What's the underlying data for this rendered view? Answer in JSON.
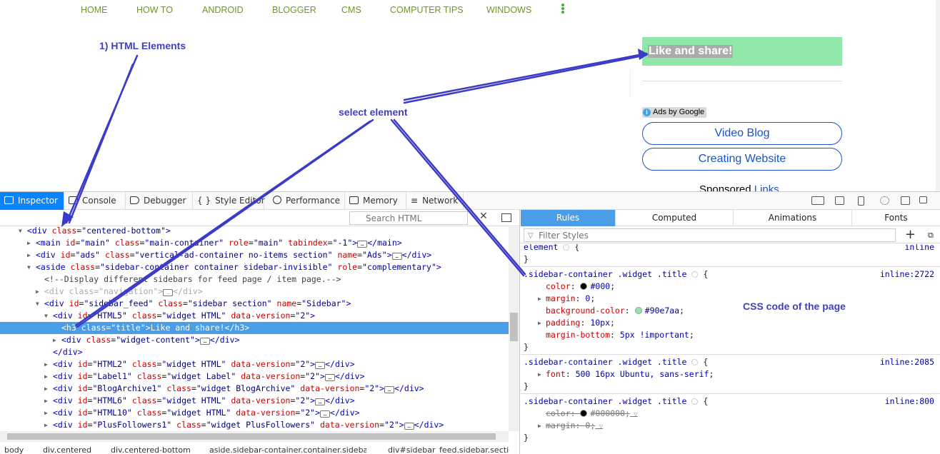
{
  "site": {
    "nav": [
      "HOME",
      "HOW TO",
      "ANDROID",
      "BLOGGER",
      "CMS",
      "COMPUTER TIPS",
      "WINDOWS"
    ],
    "like_title": "Like and share!",
    "ads_label": "Ads by Google",
    "ads_info": "i",
    "ad_links": [
      "Video Blog",
      "Creating Website"
    ],
    "sponsored_text": "Sponsored",
    "sponsored_link": "Links"
  },
  "annotations": {
    "html": "1) HTML Elements",
    "select": "select element",
    "css": "CSS code of the page"
  },
  "devtools": {
    "tabs": [
      "Inspector",
      "Console",
      "Debugger",
      "Style Editor",
      "Performance",
      "Memory",
      "Network"
    ],
    "search_placeholder": "Search HTML",
    "side_tabs": [
      "Rules",
      "Computed",
      "Animations",
      "Fonts"
    ],
    "filter_placeholder": "Filter Styles",
    "breadcrumbs": [
      "body",
      "div.centered",
      "div.centered-bottom",
      "aside.sidebar-container.container.sidebar-invisible",
      "div#sidebar_feed.sidebar.section"
    ],
    "tree": [
      {
        "open": "<div",
        "attrs": [
          [
            "class",
            "\"centered-bottom\""
          ]
        ],
        "close": ">"
      },
      {
        "open": "<main",
        "attrs": [
          [
            "id",
            "\"main\""
          ],
          [
            "class",
            "\"main-container\""
          ],
          [
            "role",
            "\"main\""
          ],
          [
            "tabindex",
            "\"-1\""
          ]
        ],
        "close": ">",
        "ell": "…",
        "end": "</main>"
      },
      {
        "open": "<div",
        "attrs": [
          [
            "id",
            "\"ads\""
          ],
          [
            "class",
            "\"vertical-ad-container no-items section\""
          ],
          [
            "name",
            "\"Ads\""
          ]
        ],
        "close": ">",
        "ell": "…",
        "end": "</div>"
      },
      {
        "open": "<aside",
        "attrs": [
          [
            "class",
            "\"sidebar-container container sidebar-invisible\""
          ],
          [
            "role",
            "\"complementary\""
          ]
        ],
        "close": ">"
      },
      {
        "comment": "<!--Display different sidebars for feed page / item page.-->"
      },
      {
        "open": "<div",
        "attrs": [
          [
            "class",
            "\"navigation\""
          ]
        ],
        "close": ">",
        "ell": "…",
        "end": "</div>"
      },
      {
        "open": "<div",
        "attrs": [
          [
            "id",
            "\"sidebar_feed\""
          ],
          [
            "class",
            "\"sidebar section\""
          ],
          [
            "name",
            "\"Sidebar\""
          ]
        ],
        "close": ">"
      },
      {
        "open": "<div",
        "attrs": [
          [
            "id",
            "\"HTML5\""
          ],
          [
            "class",
            "\"widget HTML\""
          ],
          [
            "data-version",
            "\"2\""
          ]
        ],
        "close": ">"
      },
      {
        "open": "<h3",
        "attrs": [
          [
            "class",
            "\"title\""
          ]
        ],
        "close": ">",
        "text": "Like and share!",
        "end": "</h3>"
      },
      {
        "open": "<div",
        "attrs": [
          [
            "class",
            "\"widget-content\""
          ]
        ],
        "close": ">",
        "ell": "…",
        "end": "</div>"
      },
      {
        "end_only": "</div>"
      },
      {
        "open": "<div",
        "attrs": [
          [
            "id",
            "\"HTML2\""
          ],
          [
            "class",
            "\"widget HTML\""
          ],
          [
            "data-version",
            "\"2\""
          ]
        ],
        "close": ">",
        "ell": "…",
        "end": "</div>"
      },
      {
        "open": "<div",
        "attrs": [
          [
            "id",
            "\"Label1\""
          ],
          [
            "class",
            "\"widget Label\""
          ],
          [
            "data-version",
            "\"2\""
          ]
        ],
        "close": ">",
        "ell": "…",
        "end": "</div>"
      },
      {
        "open": "<div",
        "attrs": [
          [
            "id",
            "\"BlogArchive1\""
          ],
          [
            "class",
            "\"widget BlogArchive\""
          ],
          [
            "data-version",
            "\"2\""
          ]
        ],
        "close": ">",
        "ell": "…",
        "end": "</div>"
      },
      {
        "open": "<div",
        "attrs": [
          [
            "id",
            "\"HTML6\""
          ],
          [
            "class",
            "\"widget HTML\""
          ],
          [
            "data-version",
            "\"2\""
          ]
        ],
        "close": ">",
        "ell": "…",
        "end": "</div>"
      },
      {
        "open": "<div",
        "attrs": [
          [
            "id",
            "\"HTML10\""
          ],
          [
            "class",
            "\"widget HTML\""
          ],
          [
            "data-version",
            "\"2\""
          ]
        ],
        "close": ">",
        "ell": "…",
        "end": "</div>"
      },
      {
        "open": "<div",
        "attrs": [
          [
            "id",
            "\"PlusFollowers1\""
          ],
          [
            "class",
            "\"widget PlusFollowers\""
          ],
          [
            "data-version",
            "\"2\""
          ]
        ],
        "close": ">",
        "ell": "…",
        "end": "</div>"
      }
    ],
    "rules": [
      {
        "selector": "element",
        "source": "inline",
        "props": []
      },
      {
        "selector": ".sidebar-container .widget .title",
        "source": "inline:2722",
        "props": [
          {
            "name": "color",
            "value": "#000",
            "swatch": "#000000"
          },
          {
            "name": "margin",
            "value": "0",
            "twisty": true
          },
          {
            "name": "background-color",
            "value": "#90e7aa",
            "swatch": "#90e7aa"
          },
          {
            "name": "padding",
            "value": "10px",
            "twisty": true
          },
          {
            "name": "margin-bottom",
            "value": "5px !important"
          }
        ]
      },
      {
        "selector": ".sidebar-container .widget .title",
        "source": "inline:2085",
        "props": [
          {
            "name": "font",
            "value": "500 16px Ubuntu, sans-serif",
            "twisty": true
          }
        ]
      },
      {
        "selector": ".sidebar-container .widget .title",
        "source": "inline:800",
        "props": [
          {
            "name": "color",
            "value": "#000000",
            "swatch": "#000000",
            "strike": true
          },
          {
            "name": "margin",
            "value": "0",
            "twisty": true,
            "strike": true
          }
        ]
      }
    ]
  },
  "colors": {
    "accent": "#0a84ff",
    "selection": "#4a9ee8",
    "nav_green": "#6a9a1d",
    "widget_bg": "#90e7aa",
    "annotation": "#3f3fc0"
  }
}
